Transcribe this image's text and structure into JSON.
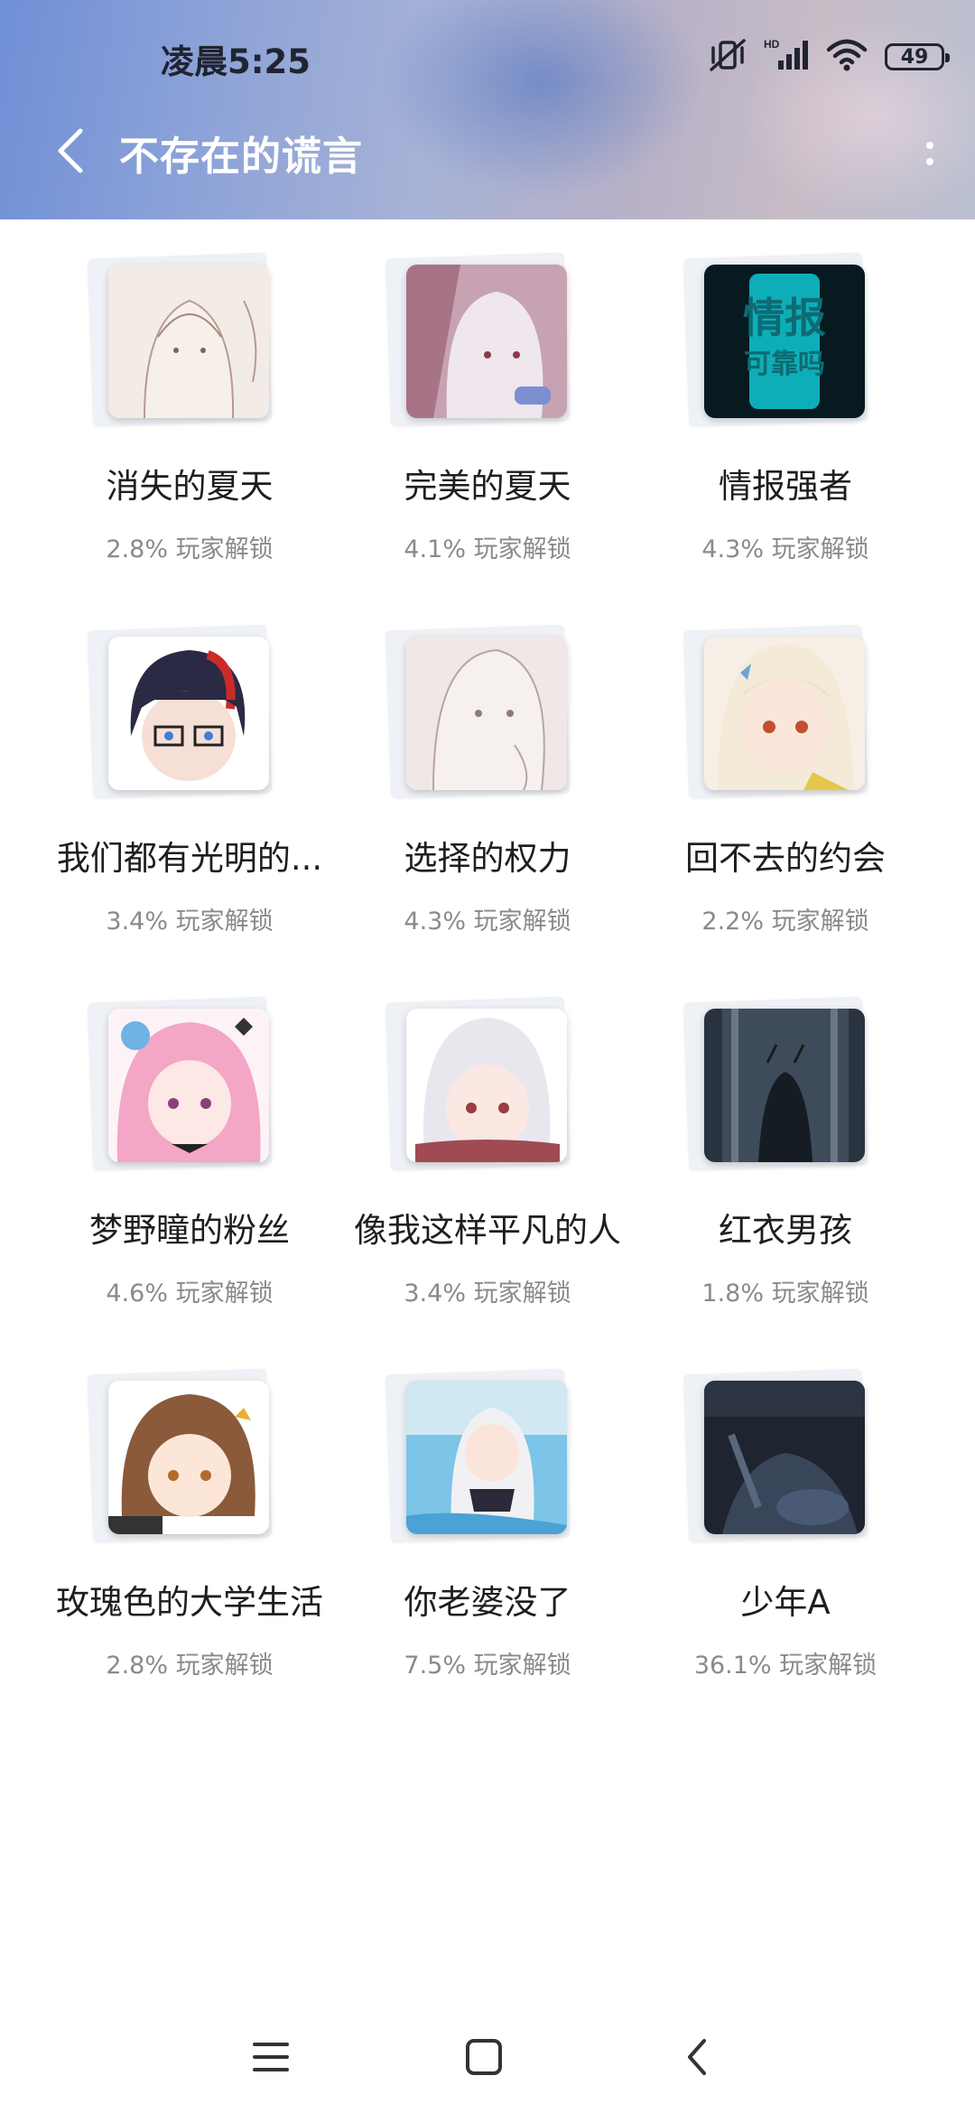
{
  "status_bar": {
    "time": "凌晨5:25",
    "battery": "49",
    "icons": [
      "mute-vibrate-icon",
      "hd-signal-icon",
      "wifi-icon",
      "battery-icon"
    ]
  },
  "header": {
    "title": "不存在的谎言",
    "back_icon": "back-arrow-icon",
    "menu_icon": "more-vertical-icon"
  },
  "achievements": [
    {
      "name": "消失的夏天",
      "unlock": "2.8% 玩家解锁"
    },
    {
      "name": "完美的夏天",
      "unlock": "4.1% 玩家解锁"
    },
    {
      "name": "情报强者",
      "unlock": "4.3% 玩家解锁",
      "badge_text_1": "情报",
      "badge_text_2": "可靠吗"
    },
    {
      "name": "我们都有光明的...",
      "unlock": "3.4% 玩家解锁"
    },
    {
      "name": "选择的权力",
      "unlock": "4.3% 玩家解锁"
    },
    {
      "name": "回不去的约会",
      "unlock": "2.2% 玩家解锁"
    },
    {
      "name": "梦野瞳的粉丝",
      "unlock": "4.6% 玩家解锁"
    },
    {
      "name": "像我这样平凡的人",
      "unlock": "3.4% 玩家解锁"
    },
    {
      "name": "红衣男孩",
      "unlock": "1.8% 玩家解锁"
    },
    {
      "name": "玫瑰色的大学生活",
      "unlock": "2.8% 玩家解锁"
    },
    {
      "name": "你老婆没了",
      "unlock": "7.5% 玩家解锁"
    },
    {
      "name": "少年A",
      "unlock": "36.1% 玩家解锁"
    }
  ],
  "nav_bar": {
    "items": [
      "menu-lines-icon",
      "home-square-icon",
      "back-chevron-icon"
    ]
  }
}
